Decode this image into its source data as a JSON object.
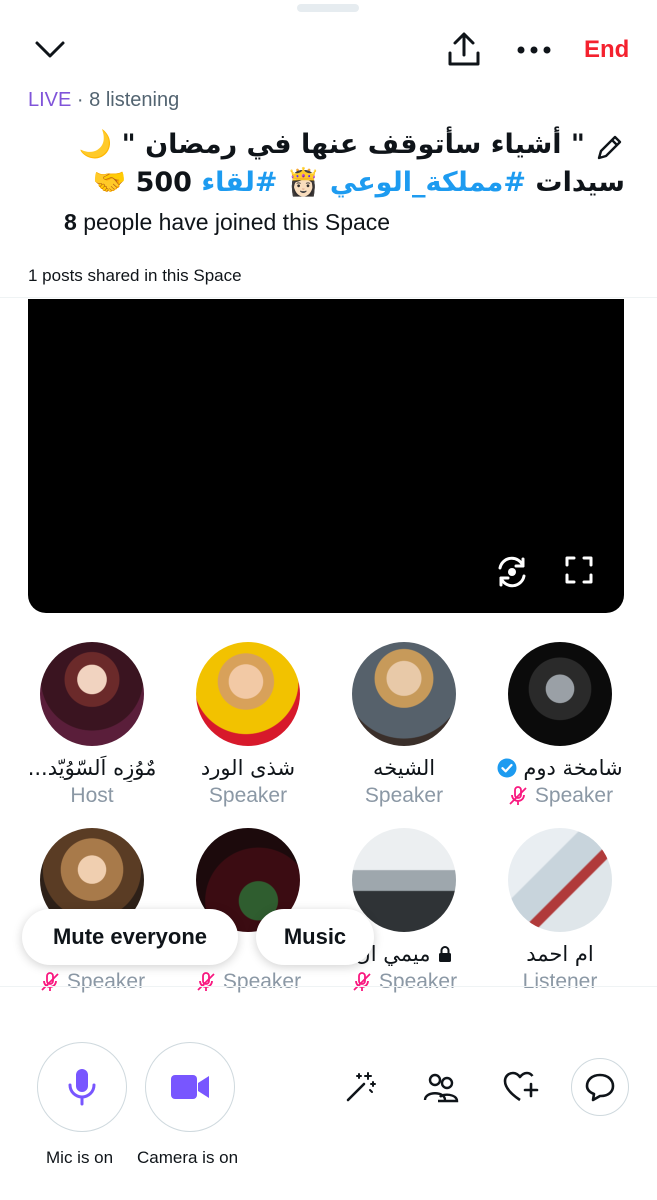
{
  "header": {
    "end_label": "End",
    "live_label": "LIVE",
    "listening_text": "· 8 listening"
  },
  "space": {
    "title_line1": "\" أشياء سأتوقف عنها في رمضان \" 🌙",
    "title_line2_prefix": "سيدات ",
    "title_hash1": "#مملكة_الوعي",
    "title_emoji": " 👸🏻 ",
    "title_hash2": "#لقاء",
    "title_line2_suffix": " 500 🤝",
    "joined_count": "8",
    "joined_text": "people have joined this Space",
    "posts_shared": "1 posts shared in this Space"
  },
  "participants": [
    {
      "name": "شامخة دوم",
      "role": "Speaker",
      "verified": true,
      "muted": true,
      "lock": false
    },
    {
      "name": "الشيخه",
      "role": "Speaker",
      "verified": false,
      "muted": false,
      "lock": false
    },
    {
      "name": "شذى الورد",
      "role": "Speaker",
      "verified": false,
      "muted": false,
      "lock": false
    },
    {
      "name": "مٌوُزِه اَلسّوُيّد...",
      "role": "Host",
      "verified": false,
      "muted": false,
      "lock": false
    },
    {
      "name": "ام احمد",
      "role": "Listener",
      "verified": false,
      "muted": false,
      "lock": false
    },
    {
      "name": "ميمي ال",
      "role": "Speaker",
      "verified": false,
      "muted": true,
      "lock": true
    },
    {
      "name": "",
      "role": "Speaker",
      "verified": false,
      "muted": true,
      "lock": false
    },
    {
      "name": "",
      "role": "Speaker",
      "verified": false,
      "muted": true,
      "lock": false
    }
  ],
  "overlay": {
    "mute_everyone": "Mute everyone",
    "music": "Music"
  },
  "controls": {
    "mic_label": "Mic is on",
    "camera_label": "Camera is on"
  },
  "icons": [
    "chevron-down-icon",
    "share-icon",
    "more-icon",
    "pencil-icon",
    "camera-flip-icon",
    "fullscreen-icon",
    "verified-icon",
    "muted-mic-icon",
    "lock-icon",
    "mic-icon",
    "video-camera-icon",
    "effects-wand-icon",
    "people-icon",
    "heart-plus-icon",
    "reply-bubble-icon"
  ],
  "colors": {
    "accent": "#8054d9",
    "end_red": "#f4212e",
    "hashtag_blue": "#1d9bf0",
    "muted_pink": "#f91880",
    "role_gray": "#8b98a5"
  }
}
